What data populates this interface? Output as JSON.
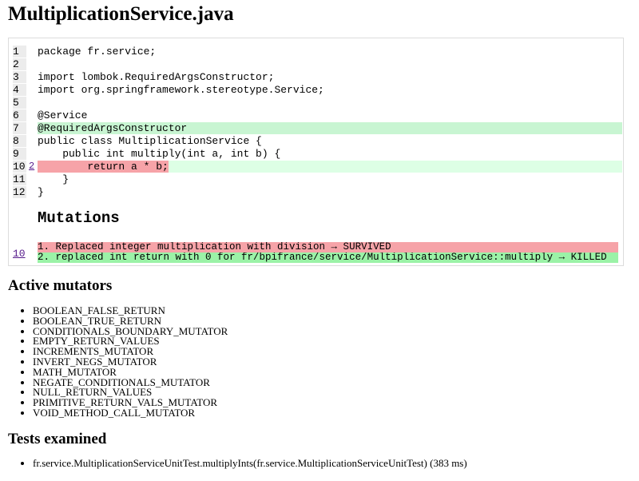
{
  "page_title": "MultiplicationService.java",
  "source_lines": [
    {
      "num": "1",
      "code": "package fr.service;",
      "status": ""
    },
    {
      "num": "2",
      "code": "",
      "status": ""
    },
    {
      "num": "3",
      "code": "import lombok.RequiredArgsConstructor;",
      "status": ""
    },
    {
      "num": "4",
      "code": "import org.springframework.stereotype.Service;",
      "status": ""
    },
    {
      "num": "5",
      "code": "",
      "status": ""
    },
    {
      "num": "6",
      "code": "@Service",
      "status": ""
    },
    {
      "num": "7",
      "code": "@RequiredArgsConstructor",
      "status": "covered"
    },
    {
      "num": "8",
      "code": "public class MultiplicationService {",
      "status": ""
    },
    {
      "num": "9",
      "code": "    public int multiply(int a, int b) {",
      "status": ""
    },
    {
      "num": "10",
      "mutation_count": "2",
      "code": "        return a * b;",
      "status": "survived"
    },
    {
      "num": "11",
      "code": "    }",
      "status": ""
    },
    {
      "num": "12",
      "code": "}",
      "status": ""
    }
  ],
  "mutations": {
    "heading": "Mutations",
    "line_link": "10",
    "items": [
      {
        "text": "1. Replaced integer multiplication with division → SURVIVED",
        "status": "survived"
      },
      {
        "text": "2. replaced int return with 0 for fr/bpifrance/service/MultiplicationService::multiply → KILLED",
        "status": "killed"
      }
    ]
  },
  "active_mutators": {
    "heading": "Active mutators",
    "items": [
      "BOOLEAN_FALSE_RETURN",
      "BOOLEAN_TRUE_RETURN",
      "CONDITIONALS_BOUNDARY_MUTATOR",
      "EMPTY_RETURN_VALUES",
      "INCREMENTS_MUTATOR",
      "INVERT_NEGS_MUTATOR",
      "MATH_MUTATOR",
      "NEGATE_CONDITIONALS_MUTATOR",
      "NULL_RETURN_VALUES",
      "PRIMITIVE_RETURN_VALS_MUTATOR",
      "VOID_METHOD_CALL_MUTATOR"
    ]
  },
  "tests_examined": {
    "heading": "Tests examined",
    "items": [
      "fr.service.MultiplicationServiceUnitTest.multiplyInts(fr.service.MultiplicationServiceUnitTest) (383 ms)"
    ]
  }
}
